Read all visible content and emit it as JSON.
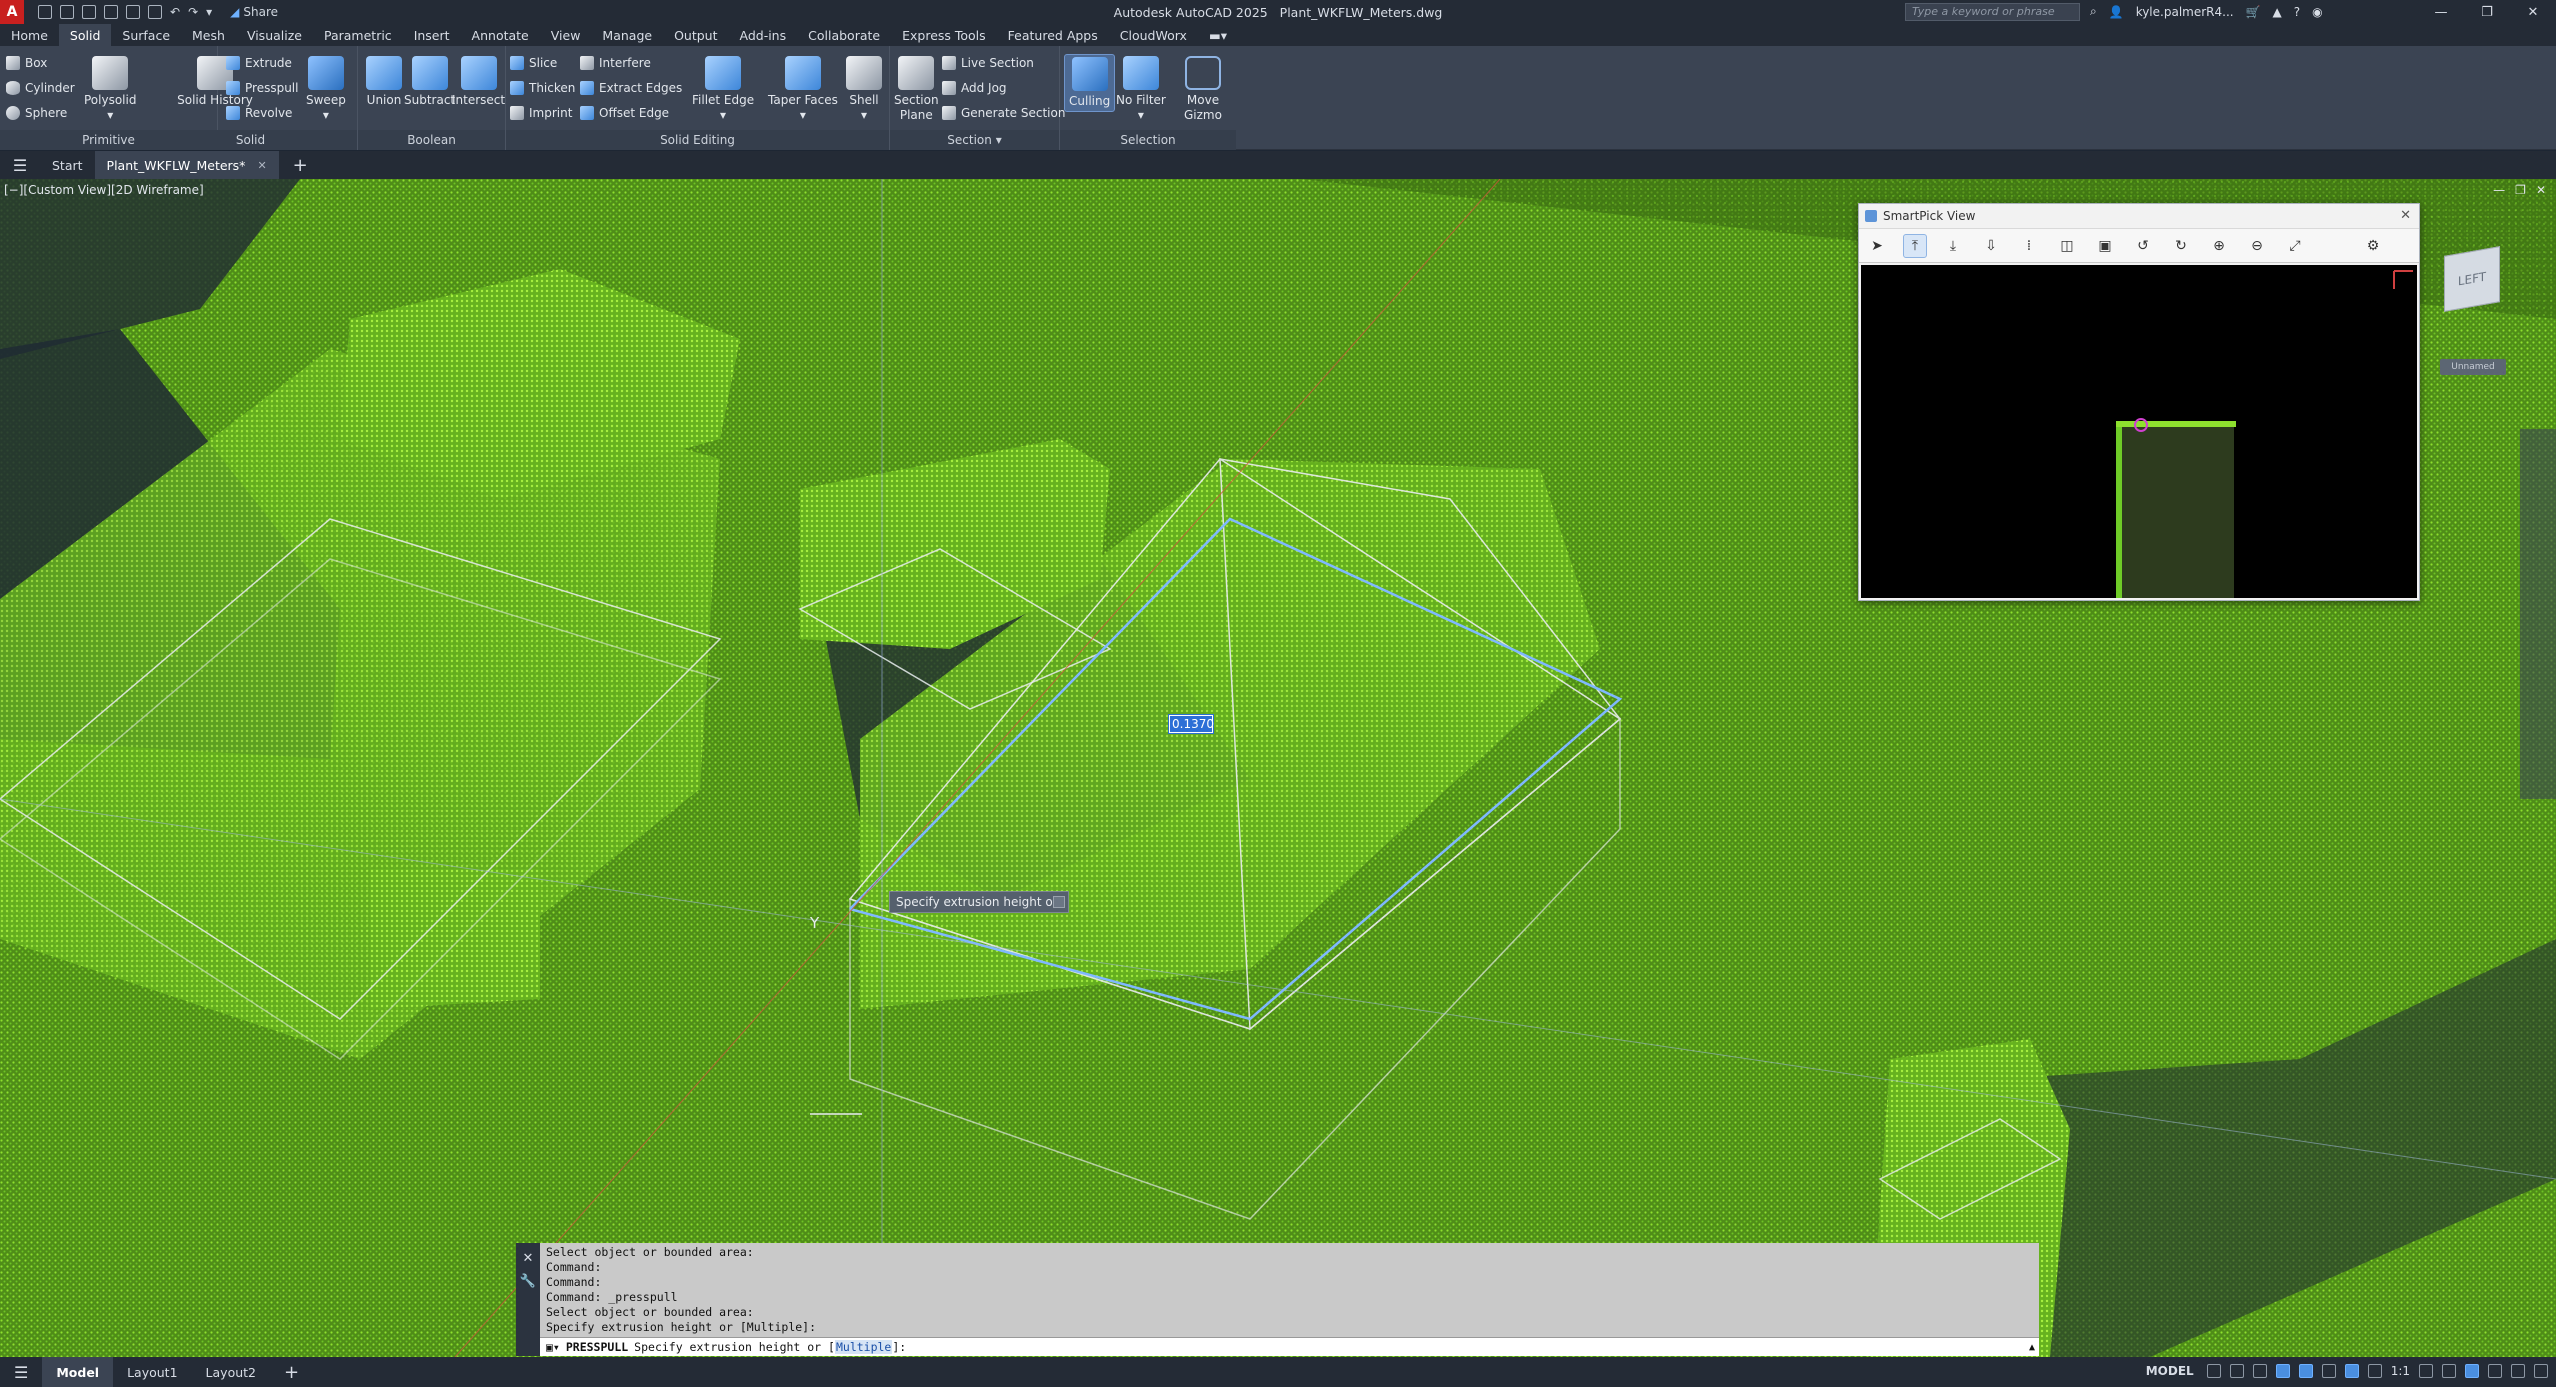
{
  "app": {
    "title": "Autodesk AutoCAD 2025",
    "file": "Plant_WKFLW_Meters.dwg",
    "logo": "A",
    "share": "Share"
  },
  "search": {
    "placeholder": "Type a keyword or phrase"
  },
  "user": {
    "name": "kyle.palmerR4..."
  },
  "menu_tabs": [
    "Home",
    "Solid",
    "Surface",
    "Mesh",
    "Visualize",
    "Parametric",
    "Insert",
    "Annotate",
    "View",
    "Manage",
    "Output",
    "Add-ins",
    "Collaborate",
    "Express Tools",
    "Featured Apps",
    "CloudWorx"
  ],
  "active_menu_tab": "Solid",
  "ribbon": {
    "primitive": {
      "title": "Primitive",
      "box": "Box",
      "cylinder": "Cylinder",
      "sphere": "Sphere",
      "polysolid": "Polysolid"
    },
    "solid": {
      "title": "Solid",
      "history": "Solid History",
      "extrude": "Extrude",
      "presspull": "Presspull",
      "revolve": "Revolve",
      "sweep": "Sweep"
    },
    "boolean": {
      "title": "Boolean",
      "union": "Union",
      "subtract": "Subtract",
      "intersect": "Intersect"
    },
    "solid_editing": {
      "title": "Solid Editing",
      "slice": "Slice",
      "thicken": "Thicken",
      "imprint": "Imprint",
      "interfere": "Interfere",
      "extract_edges": "Extract Edges",
      "offset_edge": "Offset Edge",
      "fillet_edge": "Fillet Edge",
      "taper_faces": "Taper Faces",
      "shell": "Shell"
    },
    "section": {
      "title": "Section",
      "section_plane_1": "Section",
      "section_plane_2": "Plane",
      "live_section": "Live Section",
      "add_jog": "Add Jog",
      "generate_section": "Generate Section"
    },
    "selection": {
      "title": "Selection",
      "culling": "Culling",
      "no_filter": "No Filter",
      "move_gizmo_1": "Move",
      "move_gizmo_2": "Gizmo"
    }
  },
  "doc_tabs": {
    "start": "Start",
    "active": "Plant_WKFLW_Meters*"
  },
  "viewport": {
    "label": "[−][Custom View][2D Wireframe]",
    "dynamic_input_value": "0.1370",
    "tooltip": "Specify extrusion height or",
    "y_axis": "Y",
    "viewcube_face": "LEFT",
    "viewcube_ucs": "Unnamed"
  },
  "smartpick": {
    "title": "SmartPick View"
  },
  "command": {
    "history": [
      "Select object or bounded area:",
      "Command:",
      "Command:",
      "Command: _presspull",
      "Select object or bounded area:",
      "Specify extrusion height or [Multiple]:"
    ],
    "current_cmd": "PRESSPULL",
    "prompt": "Specify extrusion height or [",
    "option": "Multiple",
    "prompt_end": "]:"
  },
  "status": {
    "layouts": [
      "Model",
      "Layout1",
      "Layout2"
    ],
    "model_label": "MODEL",
    "scale": "1:1"
  },
  "colors": {
    "points": "#7cd62a",
    "background": "#1f2a33",
    "selection_edge": "#7fb8ff",
    "accent": "#2d6fd6"
  }
}
